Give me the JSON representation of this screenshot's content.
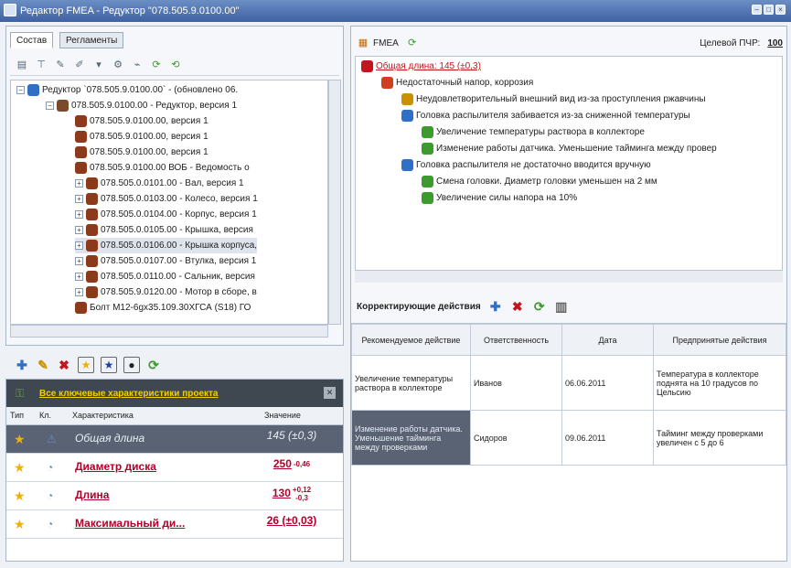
{
  "window": {
    "title": "Редактор FMEA - Редуктор \"078.505.9.0100.00\""
  },
  "left": {
    "tabs": [
      "Состав",
      "Регламенты"
    ],
    "tree": [
      {
        "label": "Редуктор `078.505.9.0100.00` - (обновлено 06.",
        "indent": 0,
        "expander": "−"
      },
      {
        "label": "078.505.9.0100.00 - Редуктор, версия 1",
        "indent": 1,
        "expander": "−"
      },
      {
        "label": "078.505.9.0100.00, версия 1",
        "indent": 2,
        "expander": ""
      },
      {
        "label": "078.505.9.0100.00, версия 1",
        "indent": 2,
        "expander": ""
      },
      {
        "label": "078.505.9.0100.00, версия 1",
        "indent": 2,
        "expander": ""
      },
      {
        "label": "078.505.9.0100.00 ВОБ - Ведомость о",
        "indent": 2,
        "expander": ""
      },
      {
        "label": "078.505.0.0101.00 - Вал, версия 1",
        "indent": 2,
        "expander": "+"
      },
      {
        "label": "078.505.0.0103.00 - Колесо, версия 1",
        "indent": 2,
        "expander": "+"
      },
      {
        "label": "078.505.0.0104.00 - Корпус, версия 1",
        "indent": 2,
        "expander": "+"
      },
      {
        "label": "078.505.0.0105.00 - Крышка, версия",
        "indent": 2,
        "expander": "+"
      },
      {
        "label": "078.505.0.0106.00 - Крышка корпуса,",
        "indent": 2,
        "expander": "+",
        "selected": true
      },
      {
        "label": "078.505.0.0107.00 - Втулка, версия 1",
        "indent": 2,
        "expander": "+"
      },
      {
        "label": "078.505.0.0110.00 - Сальник, версия",
        "indent": 2,
        "expander": "+"
      },
      {
        "label": "078.505.9.0120.00 - Мотор в сборе, в",
        "indent": 2,
        "expander": "+"
      },
      {
        "label": "Болт М12-6gх35.109.30ХГСА (S18) ГО",
        "indent": 2,
        "expander": ""
      }
    ]
  },
  "characteristics": {
    "header_link": "Все ключевые характеристики проекта",
    "columns": {
      "type": "Тип",
      "cl": "Кл.",
      "name": "Характеристика",
      "value": "Значение"
    },
    "rows": [
      {
        "name": "Общая длина",
        "value": "145 (±0,3)",
        "tol_up": "",
        "tol_down": "",
        "highlight": true
      },
      {
        "name": "Диаметр диска",
        "value": "250",
        "tol_up": "",
        "tol_down": "-0,46",
        "highlight": false
      },
      {
        "name": "Длина",
        "value": "130",
        "tol_up": "+0,12",
        "tol_down": "-0,3",
        "highlight": false
      },
      {
        "name": "Максимальный ди...",
        "value": "26 (±0,03)",
        "tol_up": "",
        "tol_down": "",
        "highlight": false
      }
    ]
  },
  "fmea": {
    "toolbar_label": "FMEA",
    "target_label": "Целевой ПЧР:",
    "target_value": "100",
    "tree": [
      {
        "label": "Общая длина: 145 (±0,3)",
        "indent": 0,
        "kind": "root"
      },
      {
        "label": "Недостаточный напор, коррозия",
        "indent": 1,
        "kind": "failure"
      },
      {
        "label": "Неудовлетворительный внешний вид из-за проступления ржавчины",
        "indent": 2,
        "kind": "effect"
      },
      {
        "label": "Головка распылителя забивается из-за сниженной температуры",
        "indent": 2,
        "kind": "cause"
      },
      {
        "label": "Увеличение температуры раствора в коллекторе",
        "indent": 3,
        "kind": "action"
      },
      {
        "label": "Изменение работы датчика. Уменьшение тайминга между провер",
        "indent": 3,
        "kind": "action"
      },
      {
        "label": "Головка распылителя не достаточно вводится вручную",
        "indent": 2,
        "kind": "cause"
      },
      {
        "label": "Смена головки. Диаметр головки уменьшен на 2 мм",
        "indent": 3,
        "kind": "action"
      },
      {
        "label": "Увеличение силы напора на 10%",
        "indent": 3,
        "kind": "action"
      }
    ]
  },
  "corrective": {
    "title": "Корректирующие действия",
    "columns": [
      "Рекомендуемое действие",
      "Ответственность",
      "Дата",
      "Предпринятые действия"
    ],
    "rows": [
      [
        "Увеличение температуры раствора в коллекторе",
        "Иванов",
        "06.06.2011",
        "Температура в коллекторе поднята на 10 градусов по Цельсию"
      ],
      [
        "Изменение работы датчика. Уменьшение тайминга между проверками",
        "Сидоров",
        "09.06.2011",
        "Тайминг между проверками увеличен с 5 до 6"
      ]
    ]
  }
}
